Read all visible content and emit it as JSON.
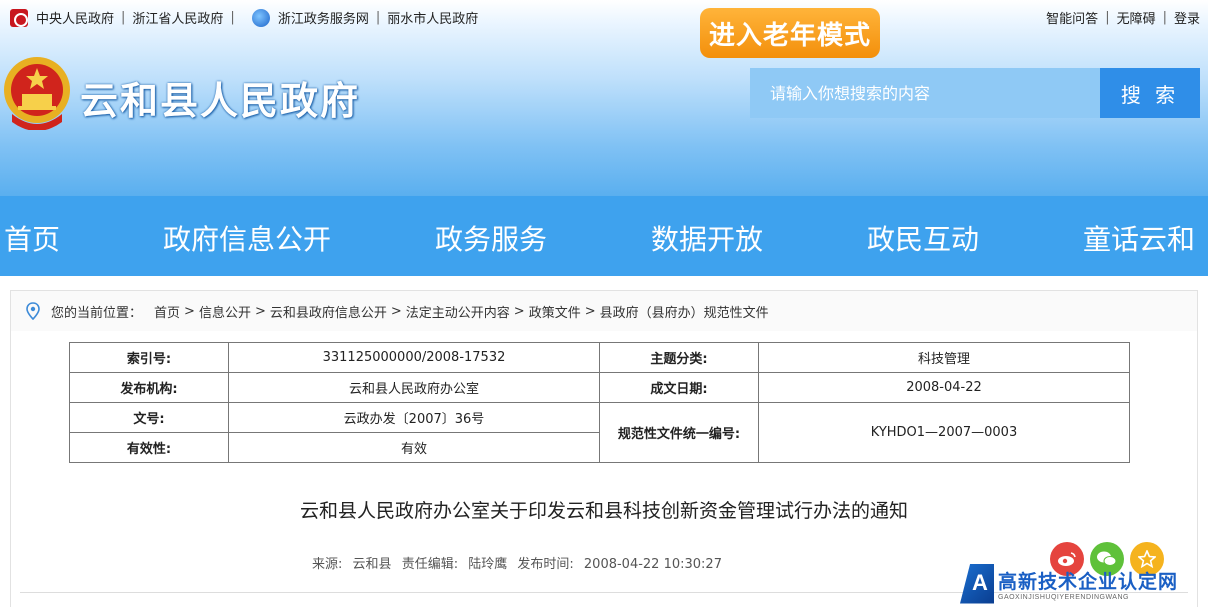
{
  "topbar": {
    "left_links_1": [
      "中央人民政府",
      "浙江省人民政府"
    ],
    "left_links_2": [
      "浙江政务服务网",
      "丽水市人民政府"
    ],
    "right_links": [
      "智能问答",
      "无障碍",
      "登录"
    ]
  },
  "elder_mode_label": "进入老年模式",
  "site_title": "云和县人民政府",
  "search": {
    "placeholder": "请输入你想搜索的内容",
    "button_label": "搜 索"
  },
  "nav": [
    "首页",
    "政府信息公开",
    "政务服务",
    "数据开放",
    "政民互动",
    "童话云和"
  ],
  "breadcrumb": {
    "prefix": "您的当前位置：",
    "items": [
      "首页",
      "信息公开",
      "云和县政府信息公开",
      "法定主动公开内容",
      "政策文件",
      "县政府（县府办）规范性文件"
    ]
  },
  "meta": {
    "index_label": "索引号:",
    "index_value": "331125000000/2008-17532",
    "topic_label": "主题分类:",
    "topic_value": "科技管理",
    "org_label": "发布机构:",
    "org_value": "云和县人民政府办公室",
    "date_label": "成文日期:",
    "date_value": "2008-04-22",
    "docno_label": "文号:",
    "docno_value": "云政办发〔2007〕36号",
    "code_label": "规范性文件统一编号:",
    "code_value": "KYHDO1—2007—0003",
    "validity_label": "有效性:",
    "validity_value": "有效"
  },
  "doc": {
    "title": "云和县人民政府办公室关于印发云和县科技创新资金管理试行办法的通知",
    "source_label": "来源:",
    "source_value": "云和县",
    "editor_label": "责任编辑:",
    "editor_value": "陆玲鹰",
    "time_label": "发布时间:",
    "time_value": "2008-04-22 10:30:27"
  },
  "watermark": {
    "main": "高新技术企业认定网",
    "sub": "GAOXINJISHUQIYERENDINGWANG",
    "logo_letter": "A"
  },
  "colors": {
    "nav_bg": "#3ea2ee",
    "elder_btn": "#f38f0b",
    "search_btn": "#2f8ee8"
  }
}
